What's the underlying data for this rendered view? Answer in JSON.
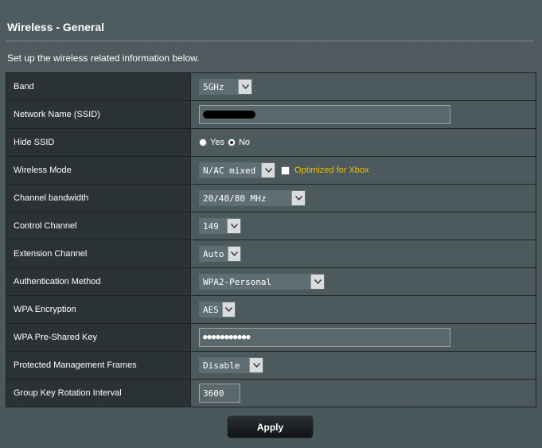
{
  "header": {
    "title": "Wireless - General",
    "description": "Set up the wireless related information below."
  },
  "fields": {
    "band": {
      "label": "Band",
      "value": "5GHz"
    },
    "ssid": {
      "label": "Network Name (SSID)",
      "value": ""
    },
    "hide_ssid": {
      "label": "Hide SSID",
      "option_yes": "Yes",
      "option_no": "No",
      "selected": "No"
    },
    "wireless_mode": {
      "label": "Wireless Mode",
      "value": "N/AC mixed",
      "xbox_label": "Optimized for Xbox",
      "xbox_checked": false
    },
    "channel_bandwidth": {
      "label": "Channel bandwidth",
      "value": "20/40/80 MHz"
    },
    "control_channel": {
      "label": "Control Channel",
      "value": "149"
    },
    "extension_channel": {
      "label": "Extension Channel",
      "value": "Auto"
    },
    "auth_method": {
      "label": "Authentication Method",
      "value": "WPA2-Personal"
    },
    "wpa_encryption": {
      "label": "WPA Encryption",
      "value": "AES"
    },
    "psk": {
      "label": "WPA Pre-Shared Key",
      "value": "●●●●●●●●●●●"
    },
    "pmf": {
      "label": "Protected Management Frames",
      "value": "Disable"
    },
    "group_key_interval": {
      "label": "Group Key Rotation Interval",
      "value": "3600"
    }
  },
  "actions": {
    "apply_label": "Apply"
  },
  "colors": {
    "background": "#4d5a5e",
    "label_cell": "#2b3236",
    "value_cell": "#4c595d",
    "xbox_text": "#f0c000"
  }
}
